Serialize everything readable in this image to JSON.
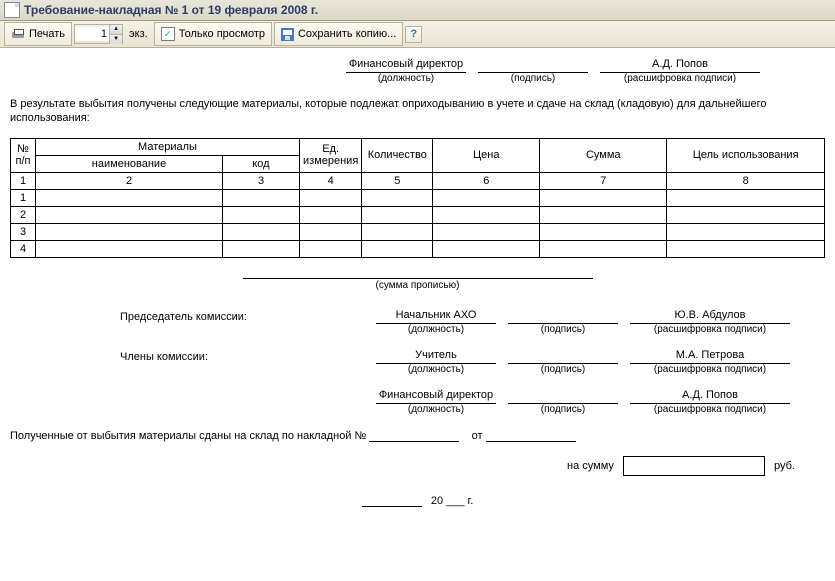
{
  "titlebar": {
    "title": "Требование-накладная № 1 от 19 февраля 2008 г."
  },
  "toolbar": {
    "print": "Печать",
    "copies_value": "1",
    "copies_suffix": "экз.",
    "preview_checked": "✓",
    "preview_label": "Только просмотр",
    "save_copy": "Сохранить копию...",
    "help": "?"
  },
  "header_sig": {
    "position_value": "Финансовый директор",
    "position_label": "(должность)",
    "sign_label": "(подпись)",
    "name_value": "А.Д. Попов",
    "name_label": "(расшифровка подписи)"
  },
  "paragraph": "В результате выбытия получены следующие материалы, которые подлежат оприходыванию в учете и сдаче на склад (кладовую) для дальнейшего использования:",
  "table": {
    "headers": {
      "np": "№ п/п",
      "materials": "Материалы",
      "name": "наименование",
      "code": "код",
      "unit": "Ед. измерения",
      "qty": "Количество",
      "price": "Цена",
      "sum": "Сумма",
      "purpose": "Цель использования"
    },
    "col_nums": {
      "np": "1",
      "name": "2",
      "code": "3",
      "unit": "4",
      "qty": "5",
      "price": "6",
      "sum": "7",
      "purpose": "8"
    },
    "rows": [
      "1",
      "2",
      "3",
      "4"
    ]
  },
  "sum_words_label": "(сумма прописью)",
  "sig_chair": {
    "label": "Председатель комиссии:",
    "position": "Начальник АХО",
    "position_label": "(должность)",
    "sign_label": "(подпись)",
    "name": "Ю.В. Абдулов",
    "name_label": "(расшифровка подписи)"
  },
  "sig_members": {
    "label": "Члены комиссии:",
    "m1": {
      "position": "Учитель",
      "name": "М.А. Петрова"
    },
    "m2": {
      "position": "Финансовый директор",
      "name": "А.Д. Попов"
    },
    "position_label": "(должность)",
    "sign_label": "(подпись)",
    "name_label": "(расшифровка подписи)"
  },
  "footer": {
    "sent_text": "Полученные от выбытия материалы сданы на склад по накладной №",
    "ot": "от",
    "na_summu": "на сумму",
    "rub": "руб.",
    "date_day": "",
    "date_year_suffix": "20 ___ г."
  }
}
